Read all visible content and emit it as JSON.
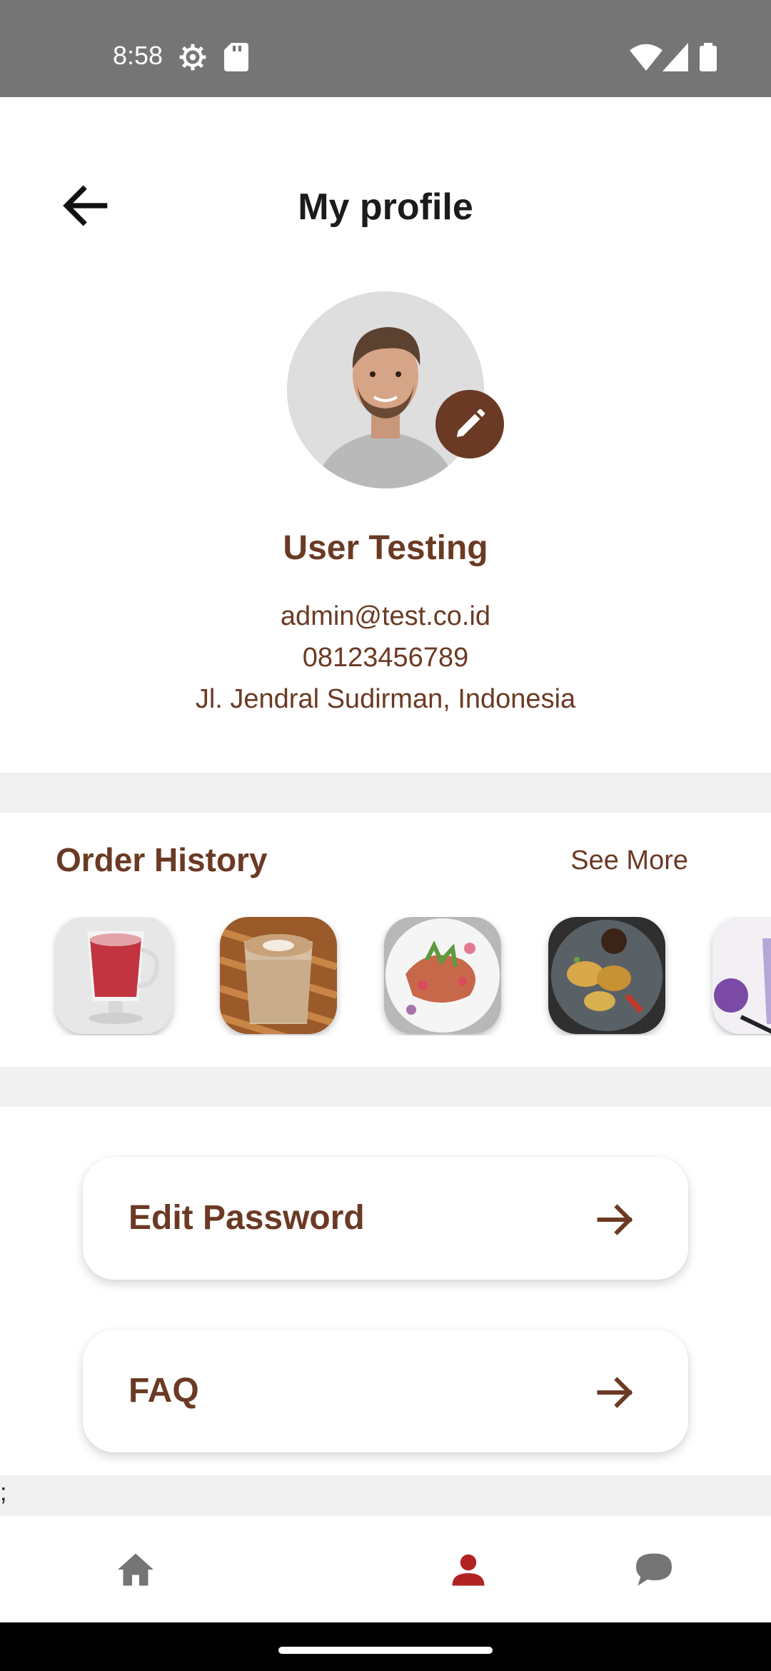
{
  "status_bar": {
    "time": "8:58",
    "left_icons": [
      "settings-gear-icon",
      "sd-card-icon"
    ],
    "right_icons": [
      "wifi-icon",
      "cellular-signal-icon",
      "battery-icon"
    ]
  },
  "header": {
    "title": "My profile",
    "back_icon": "arrow-left-icon"
  },
  "profile": {
    "name": "User Testing",
    "email": "admin@test.co.id",
    "phone": "08123456789",
    "address": "Jl. Jendral Sudirman, Indonesia",
    "edit_icon": "pencil-icon"
  },
  "order_history": {
    "title": "Order History",
    "see_more": "See More",
    "items": [
      {
        "name": "red-velvet-latte-thumbnail"
      },
      {
        "name": "cafe-latte-art-thumbnail"
      },
      {
        "name": "salad-dish-thumbnail"
      },
      {
        "name": "fried-snack-platter-thumbnail"
      },
      {
        "name": "purple-drink-thumbnail"
      }
    ]
  },
  "menu": {
    "edit_password": "Edit Password",
    "faq": "FAQ"
  },
  "misc": {
    "stray_char": ";"
  },
  "bottom_nav": {
    "items": [
      "home-icon",
      "profile-icon",
      "chat-icon"
    ],
    "active": "profile-icon"
  },
  "colors": {
    "brand_brown": "#6b3a24",
    "active_nav": "#b22323",
    "inactive_nav": "#757575",
    "status_bar": "#757575",
    "divider": "#f0f0f0"
  }
}
